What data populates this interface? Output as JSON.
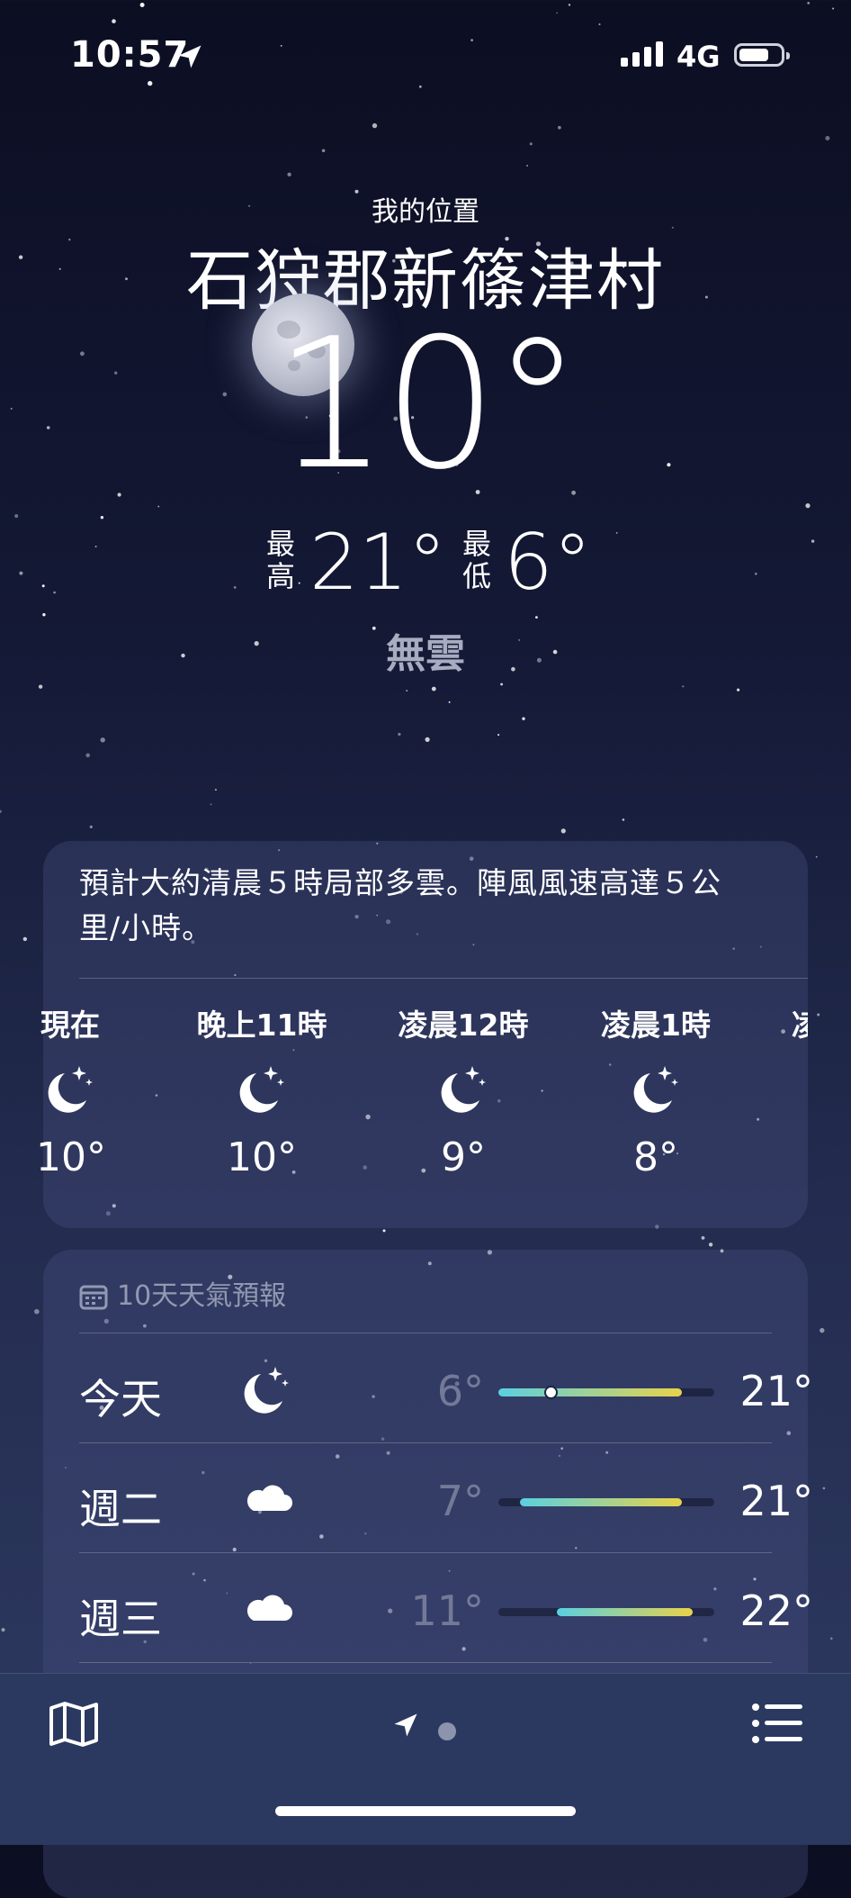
{
  "status_bar": {
    "time": "10:57",
    "network": "4G"
  },
  "location": {
    "caption": "我的位置",
    "name": "石狩郡新篠津村"
  },
  "current": {
    "temp": "10°",
    "high_label": "最高",
    "high": "21°",
    "low_label": "最低",
    "low": "6°",
    "condition": "無雲"
  },
  "hourly_card": {
    "summary": "預計大約清晨５時局部多雲。陣風風速高達５公里/小時。",
    "hours": [
      {
        "label": "現在",
        "icon": "moon-stars-icon",
        "temp": "10°"
      },
      {
        "label": "晚上11時",
        "icon": "moon-stars-icon",
        "temp": "10°"
      },
      {
        "label": "凌晨12時",
        "icon": "moon-stars-icon",
        "temp": "9°"
      },
      {
        "label": "凌晨1時",
        "icon": "moon-stars-icon",
        "temp": "8°"
      },
      {
        "label": "凌",
        "icon": "",
        "temp": ""
      }
    ]
  },
  "daily_card": {
    "header": "10天天氣預報",
    "days": [
      {
        "day": "今天",
        "icon": "moon-stars-icon",
        "low": "6°",
        "high": "21°",
        "range_start": 0.0,
        "range_end": 0.85,
        "current_marker": 0.24
      },
      {
        "day": "週二",
        "icon": "cloud-icon",
        "low": "7°",
        "high": "21°",
        "range_start": 0.1,
        "range_end": 0.85
      },
      {
        "day": "週三",
        "icon": "cloud-icon",
        "low": "11°",
        "high": "22°",
        "range_start": 0.27,
        "range_end": 0.9
      }
    ]
  },
  "colors": {
    "bar_cool": "#5ad0e0",
    "bar_warm": "#e8d24a",
    "muted": "#737a98"
  }
}
